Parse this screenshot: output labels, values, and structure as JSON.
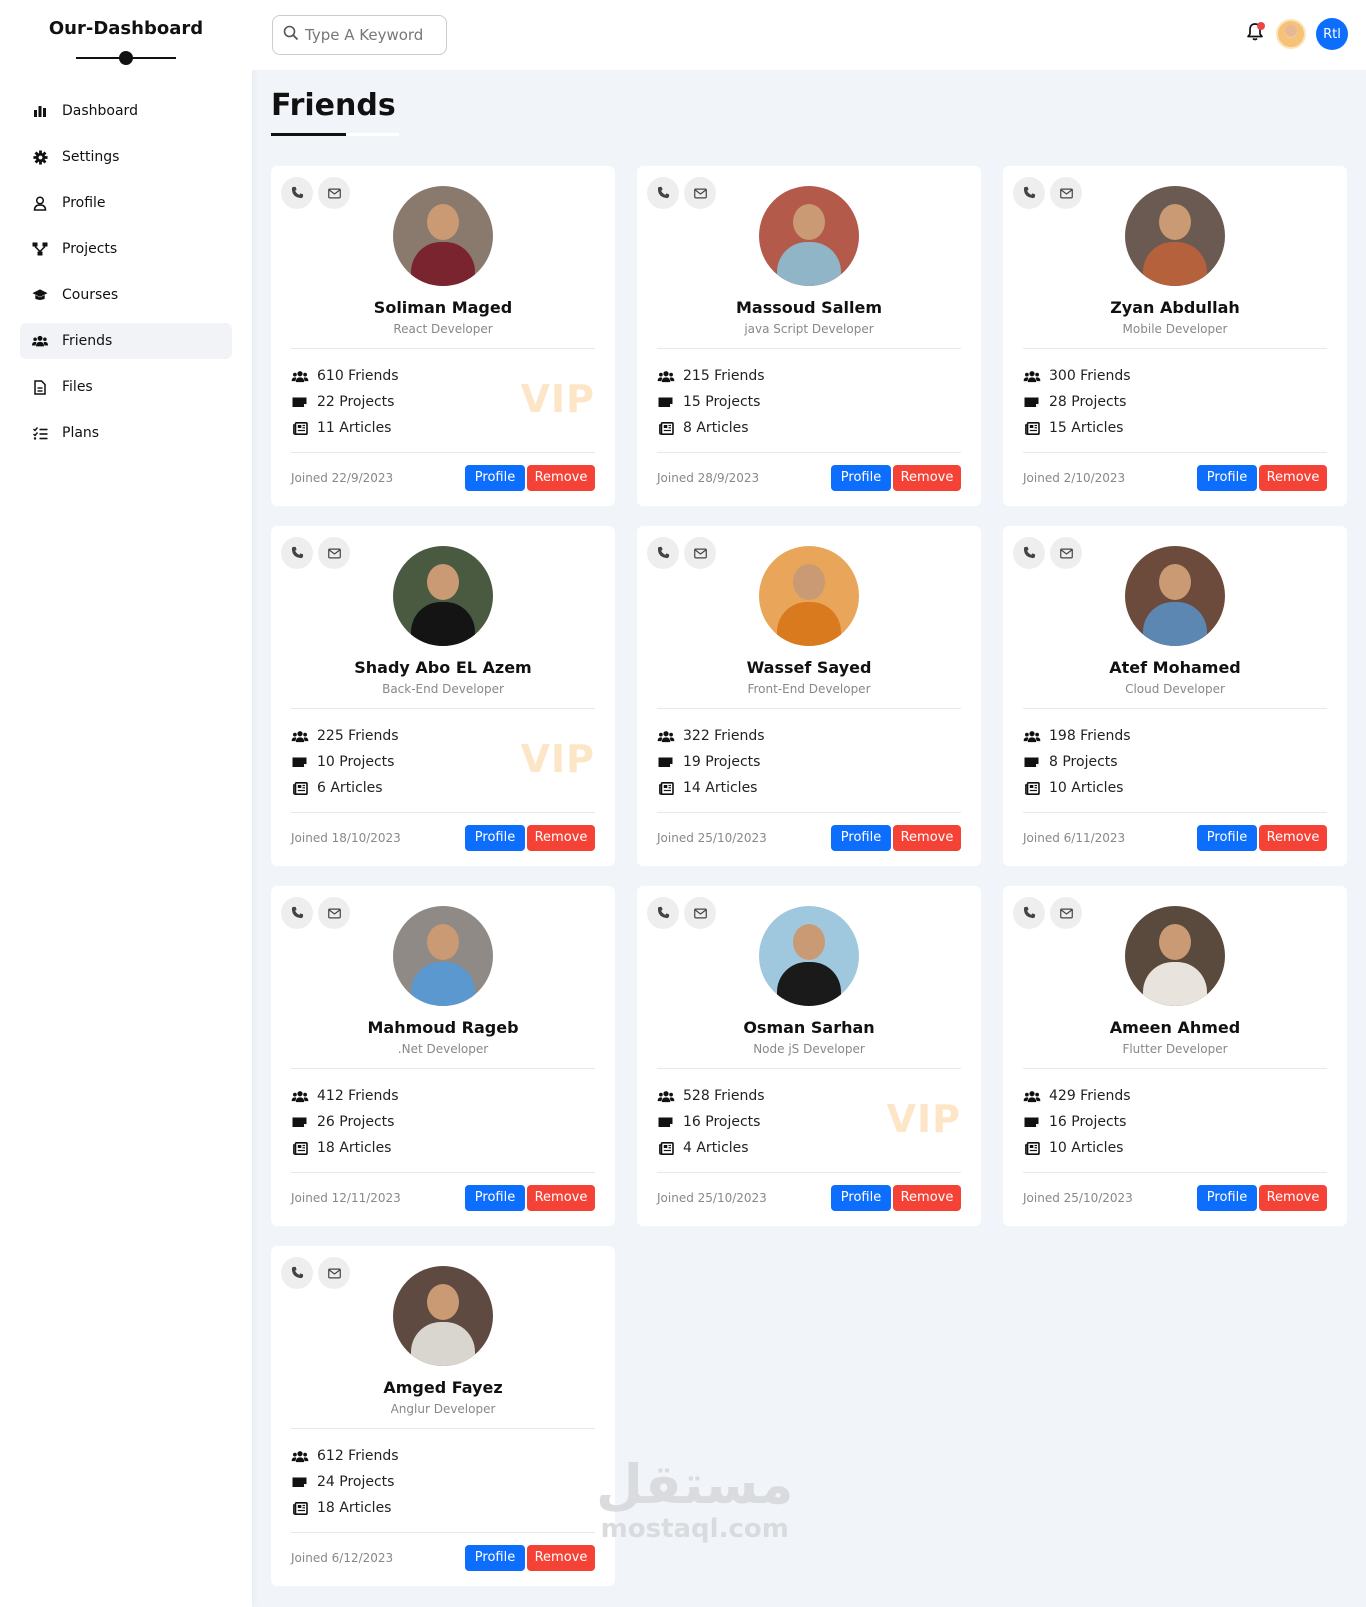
{
  "brand": "Our-Dashboard",
  "search": {
    "placeholder": "Type A Keyword"
  },
  "header": {
    "rtl_label": "Rtl"
  },
  "sidebar": {
    "items": [
      {
        "label": "Dashboard",
        "icon": "chart-bar-icon"
      },
      {
        "label": "Settings",
        "icon": "gear-icon"
      },
      {
        "label": "Profile",
        "icon": "user-icon"
      },
      {
        "label": "Projects",
        "icon": "diagram-icon"
      },
      {
        "label": "Courses",
        "icon": "graduation-cap-icon"
      },
      {
        "label": "Friends",
        "icon": "users-icon",
        "active": true
      },
      {
        "label": "Files",
        "icon": "file-icon"
      },
      {
        "label": "Plans",
        "icon": "list-check-icon"
      }
    ]
  },
  "page": {
    "title": "Friends"
  },
  "colors": {
    "primary": "#0d6efd",
    "danger": "#f44336",
    "vip": "#fde6c8",
    "background": "#f1f5f9"
  },
  "buttons": {
    "profile": "Profile",
    "remove": "Remove"
  },
  "friends": [
    {
      "name": "Soliman Maged",
      "role": "React Developer",
      "friends": "610 Friends",
      "projects": "22 Projects",
      "articles": "11 Articles",
      "joined": "Joined 22/9/2023",
      "vip": "VIP",
      "bg": "#8a7a6e",
      "shirt": "#7a2430"
    },
    {
      "name": "Massoud Sallem",
      "role": "java Script Developer",
      "friends": "215 Friends",
      "projects": "15 Projects",
      "articles": "8 Articles",
      "joined": "Joined 28/9/2023",
      "vip": "",
      "bg": "#b35a4a",
      "shirt": "#8fb5c7"
    },
    {
      "name": "Zyan Abdullah",
      "role": "Mobile Developer",
      "friends": "300 Friends",
      "projects": "28 Projects",
      "articles": "15 Articles",
      "joined": "Joined 2/10/2023",
      "vip": "",
      "bg": "#6b5a52",
      "shirt": "#b5623c"
    },
    {
      "name": "Shady Abo EL Azem",
      "role": "Back-End Developer",
      "friends": "225 Friends",
      "projects": "10 Projects",
      "articles": "6 Articles",
      "joined": "Joined 18/10/2023",
      "vip": "VIP",
      "bg": "#4a5a40",
      "shirt": "#141414"
    },
    {
      "name": "Wassef Sayed",
      "role": "Front-End Developer",
      "friends": "322 Friends",
      "projects": "19 Projects",
      "articles": "14 Articles",
      "joined": "Joined 25/10/2023",
      "vip": "",
      "bg": "#e9a65a",
      "shirt": "#d97a1e"
    },
    {
      "name": "Atef Mohamed",
      "role": "Cloud Developer",
      "friends": "198 Friends",
      "projects": "8 Projects",
      "articles": "10 Articles",
      "joined": "Joined 6/11/2023",
      "vip": "",
      "bg": "#6c4a3c",
      "shirt": "#5d87b3"
    },
    {
      "name": "Mahmoud Rageb",
      "role": ".Net Developer",
      "friends": "412 Friends",
      "projects": "26 Projects",
      "articles": "18 Articles",
      "joined": "Joined 12/11/2023",
      "vip": "",
      "bg": "#8f8a86",
      "shirt": "#5b98cf"
    },
    {
      "name": "Osman Sarhan",
      "role": "Node jS Developer",
      "friends": "528 Friends",
      "projects": "16 Projects",
      "articles": "4 Articles",
      "joined": "Joined 25/10/2023",
      "vip": "VIP",
      "bg": "#9fc8df",
      "shirt": "#1a1a1a"
    },
    {
      "name": "Ameen Ahmed",
      "role": "Flutter Developer",
      "friends": "429 Friends",
      "projects": "16 Projects",
      "articles": "10 Articles",
      "joined": "Joined 25/10/2023",
      "vip": "",
      "bg": "#5a4a3e",
      "shirt": "#e8e3dc"
    },
    {
      "name": "Amged Fayez",
      "role": "Anglur Developer",
      "friends": "612 Friends",
      "projects": "24 Projects",
      "articles": "18 Articles",
      "joined": "Joined 6/12/2023",
      "vip": "",
      "bg": "#5e4a40",
      "shirt": "#d9d6d0"
    }
  ],
  "watermark": {
    "arabic": "مستقل",
    "latin": "mostaql.com"
  }
}
